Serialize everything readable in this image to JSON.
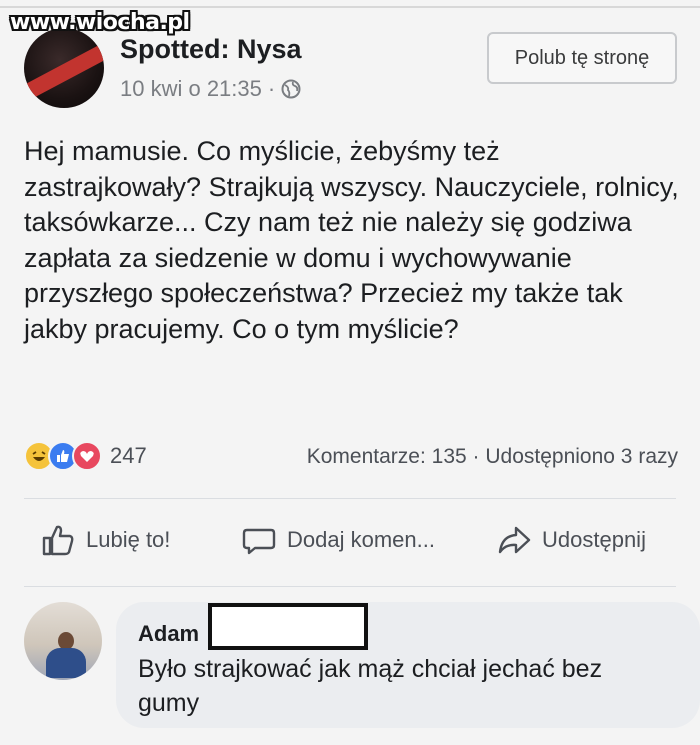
{
  "watermark": "www.wiocha.pl",
  "page": {
    "name": "Spotted: Nysa",
    "timestamp": "10 kwi o 21:35",
    "separator": "·",
    "like_page_label": "Polub tę stronę"
  },
  "post": {
    "text": "Hej mamusie. Co myślicie, żebyśmy też zastrajkowały? Strajkują wszyscy. Nauczyciele, rolnicy, taksówkarze... Czy nam też nie należy się godziwa zapłata za siedzenie w domu i wychowywanie przyszłego społeczeństwa? Przecież my także tak jakby pracujemy. Co o tym myślicie?"
  },
  "reactions": {
    "icons": [
      "haha-icon",
      "like-icon",
      "love-icon"
    ],
    "count": "247"
  },
  "stats": {
    "comments": "Komentarze: 135",
    "shares": "Udostępniono 3 razy",
    "separator": "·"
  },
  "actions": {
    "like": "Lubię to!",
    "comment": "Dodaj komen...",
    "share": "Udostępnij"
  },
  "comment": {
    "author": "Adam",
    "text": "Było strajkować jak mąż chciał jechać bez gumy"
  },
  "colors": {
    "like_blue": "#3b7cf0",
    "love_red": "#e8485f",
    "haha_yellow": "#f5c33b",
    "comment_bubble": "#ebedf0"
  }
}
